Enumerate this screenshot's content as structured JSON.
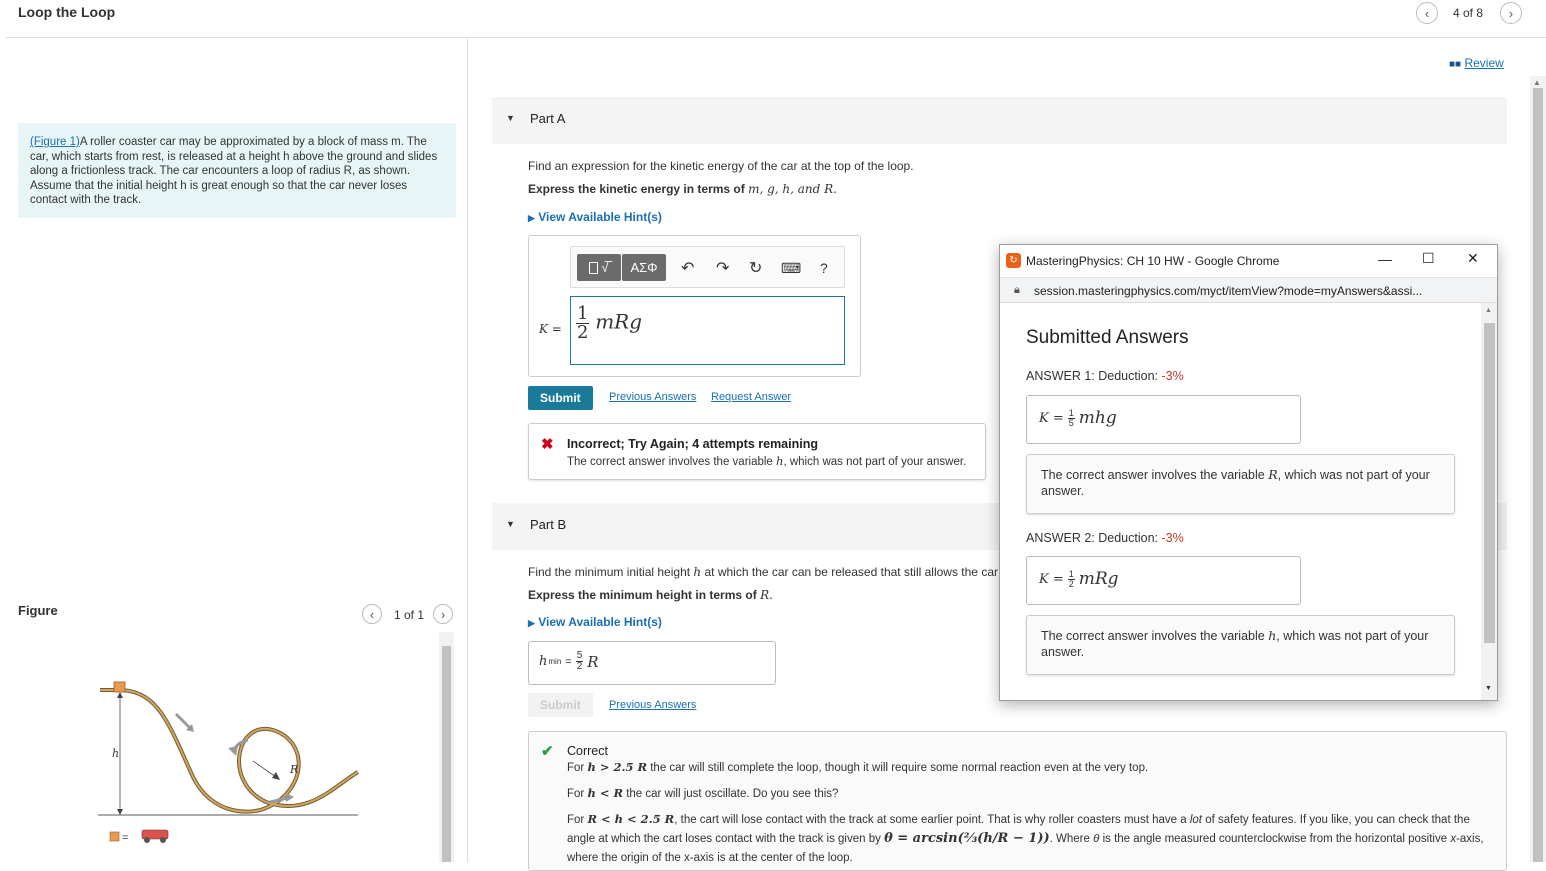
{
  "header": {
    "title": "Loop the Loop",
    "pager": "4 of 8"
  },
  "review": {
    "label": "Review"
  },
  "problem": {
    "figure_link": "(Figure 1)",
    "text": "A roller coaster car may be approximated by a block of mass m. The car, which starts from rest, is released at a height h above the ground and slides along a frictionless track. The car encounters a loop of radius R, as shown. Assume that the initial height h is great enough so that the car never loses contact with the track."
  },
  "figure": {
    "label": "Figure",
    "pager": "1 of 1",
    "h_label": "h",
    "r_label": "R",
    "legend_eq": "="
  },
  "partA": {
    "label": "Part A",
    "question": "Find an expression for the kinetic energy of the car at the top of the loop.",
    "instruction_prefix": "Express the kinetic energy in terms of",
    "instruction_vars": "m, g, h, and R.",
    "hints": "View Available Hint(s)",
    "toolbar": {
      "templates": "√̅",
      "symbols": "ΑΣΦ",
      "help": "?"
    },
    "answer_lhs": "K =",
    "answer_num": "1",
    "answer_den": "2",
    "answer_rest": "mRg",
    "submit": "Submit",
    "previous_answers": "Previous Answers",
    "request_answer": "Request Answer",
    "feedback_title": "Incorrect; Try Again; 4 attempts remaining",
    "feedback_prefix": "The correct answer involves the variable",
    "feedback_var": "h",
    "feedback_suffix": ", which was not part of your answer."
  },
  "partB": {
    "label": "Part B",
    "question_prefix": "Find the minimum initial height",
    "question_var": "h",
    "question_suffix": "at which the car can be released that still allows the car to",
    "instruction_prefix": "Express the minimum height in terms of",
    "instruction_var": "R.",
    "hints": "View Available Hint(s)",
    "answer_lhs": "h",
    "answer_sub": "min",
    "answer_eq": "=",
    "answer_num": "5",
    "answer_den": "2",
    "answer_rest": "R",
    "submit": "Submit",
    "previous_answers": "Previous Answers",
    "correct_title": "Correct",
    "line1_a": "For",
    "line1_math": "h > 2.5 R",
    "line1_b": "the car will still complete the loop, though it will require some normal reaction even at the very top.",
    "line2_a": "For",
    "line2_math": "h < R",
    "line2_b": "the car will just oscillate. Do you see this?",
    "line3_a": "For",
    "line3_math": "R < h < 2.5 R",
    "line3_b": ", the cart will lose contact with the track at some earlier point. That is why roller coasters must have a",
    "line3_lot": "lot",
    "line3_c": "of safety features. If you like, you can check that the",
    "line4_a": "angle at which the cart loses contact with the track is given by",
    "line4_math": "θ = arcsin(⅔(h/R − 1))",
    "line4_b": ". Where",
    "line4_theta": "θ",
    "line4_c": "is the angle measured counterclockwise from the horizontal positive",
    "line4_x": "x",
    "line4_d": "-axis,",
    "line5": "where the origin of the x-axis is at the center of the loop."
  },
  "popup": {
    "window_title": "MasteringPhysics: CH 10 HW - Google Chrome",
    "url": "session.masteringphysics.com/myct/itemView?mode=myAnswers&assi...",
    "heading": "Submitted Answers",
    "answer1_label": "ANSWER 1:",
    "answer1_deduction_label": "Deduction:",
    "answer1_deduction": "-3%",
    "answer1_lhs": "K =",
    "answer1_num": "1",
    "answer1_den": "5",
    "answer1_rest": "mhg",
    "answer1_msg_prefix": "The correct answer involves the variable",
    "answer1_msg_var": "R",
    "answer1_msg_suffix": ", which was not part of your answer.",
    "answer2_label": "ANSWER 2:",
    "answer2_deduction_label": "Deduction:",
    "answer2_deduction": "-3%",
    "answer2_lhs": "K =",
    "answer2_num": "1",
    "answer2_den": "2",
    "answer2_rest": "mRg",
    "answer2_msg_prefix": "The correct answer involves the variable",
    "answer2_msg_var": "h",
    "answer2_msg_suffix": ", which was not part of your answer."
  },
  "colors": {
    "accent": "#1a7a9a",
    "link": "#1a6fb5",
    "error": "#d0021b",
    "success": "#2e9e3e",
    "deduction": "#c0392b",
    "problem_bg": "#e8f5f7"
  }
}
